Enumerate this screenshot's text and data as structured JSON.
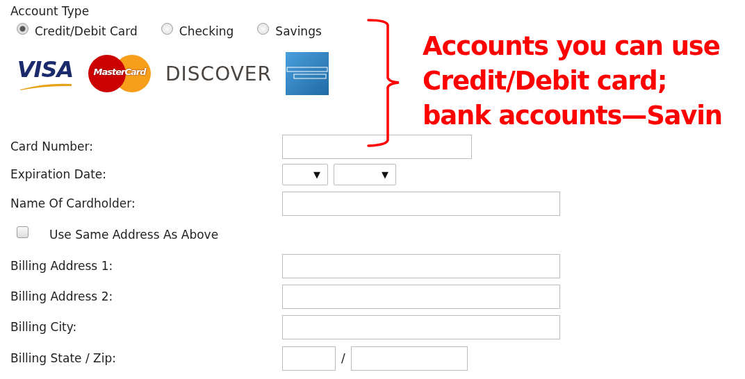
{
  "account_type": {
    "label": "Account Type",
    "options": [
      {
        "label": "Credit/Debit Card",
        "selected": true
      },
      {
        "label": "Checking",
        "selected": false
      },
      {
        "label": "Savings",
        "selected": false
      }
    ]
  },
  "card_logos": [
    {
      "kind": "visa",
      "label": "VISA"
    },
    {
      "kind": "mastercard",
      "label": "MasterCard"
    },
    {
      "kind": "discover",
      "label": "DISCOVER"
    },
    {
      "kind": "amex"
    }
  ],
  "fields": [
    {
      "kind": "short-text",
      "label": "Card Number:"
    },
    {
      "kind": "selects",
      "label": "Expiration Date:",
      "arrows": [
        "▼",
        "▼"
      ]
    },
    {
      "kind": "text",
      "label": "Name Of Cardholder:"
    },
    {
      "kind": "checkbox",
      "label": "Use Same Address As Above",
      "checked": false
    },
    {
      "kind": "text",
      "label": "Billing Address 1:"
    },
    {
      "kind": "text",
      "label": "Billing Address 2:"
    },
    {
      "kind": "text",
      "label": "Billing City:"
    },
    {
      "kind": "statezip",
      "label": "Billing State / Zip:",
      "separator": "/"
    }
  ],
  "annotation": {
    "lines": [
      "Accounts you can use",
      "Credit/Debit card;",
      "bank accounts—Savin"
    ]
  }
}
